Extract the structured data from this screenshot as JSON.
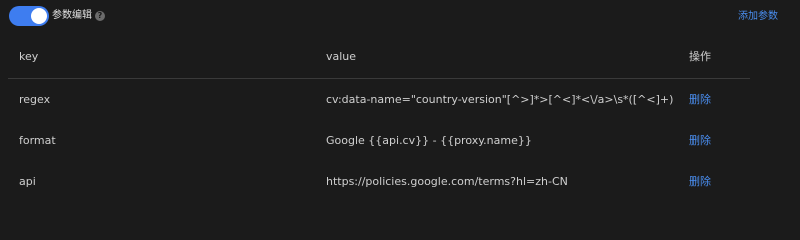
{
  "toolbar": {
    "toggle_label": "参数编辑",
    "toggle_on": true,
    "help_icon": "question-icon",
    "add_param_label": "添加参数",
    "accent_color": "#3e7df0"
  },
  "table": {
    "headers": {
      "key": "key",
      "value": "value",
      "op": "操作"
    },
    "rows": [
      {
        "key": "regex",
        "value": "cv:data-name=\"country-version\"[^>]*>[^<]*<\\/a>\\s*([^<]+)",
        "action": "删除"
      },
      {
        "key": "format",
        "value": "Google {{api.cv}} - {{proxy.name}}",
        "action": "删除"
      },
      {
        "key": "api",
        "value": "https://policies.google.com/terms?hl=zh-CN",
        "action": "删除"
      }
    ]
  }
}
